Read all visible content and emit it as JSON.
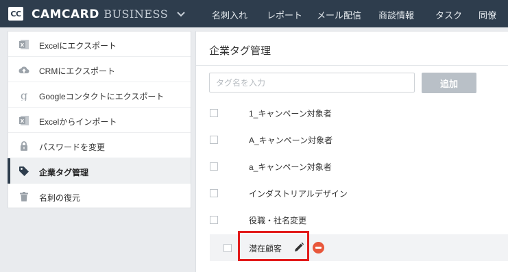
{
  "header": {
    "logo_mark": "CC",
    "brand_main": "CAMCARD",
    "brand_sub": "BUSINESS",
    "nav": [
      "名刺入れ",
      "レポート",
      "メール配信",
      "商談情報",
      "タスク",
      "同僚"
    ]
  },
  "sidebar": {
    "items": [
      {
        "label": "Excelにエクスポート",
        "icon": "excel-icon"
      },
      {
        "label": "CRMにエクスポート",
        "icon": "cloud-upload-icon"
      },
      {
        "label": "Googleコンタクトにエクスポート",
        "icon": "google-icon"
      },
      {
        "label": "Excelからインポート",
        "icon": "excel-icon"
      },
      {
        "label": "パスワードを変更",
        "icon": "lock-icon"
      },
      {
        "label": "企業タグ管理",
        "icon": "tag-icon",
        "active": true
      },
      {
        "label": "名刺の復元",
        "icon": "trash-icon"
      }
    ]
  },
  "main": {
    "title": "企業タグ管理",
    "input_placeholder": "タグ名を入力",
    "input_value": "",
    "add_label": "追加",
    "tags": [
      "1_キャンペーン対象者",
      "A_キャンペーン対象者",
      "a_キャンペーン対象者",
      "インダストリアルデザイン",
      "役職・社名変更",
      "潜在顧客"
    ]
  },
  "colors": {
    "topbar": "#2e3d4d",
    "delete": "#e8573b",
    "highlight": "#e21b1b",
    "button_disabled": "#b9c0c7"
  }
}
